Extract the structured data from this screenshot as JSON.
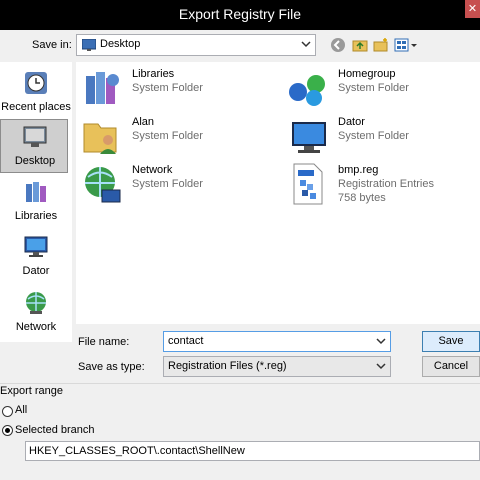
{
  "window": {
    "title": "Export Registry File",
    "close_icon": "close-icon"
  },
  "toolbar": {
    "save_in_label": "Save in:",
    "location": "Desktop",
    "icons": [
      "back-icon",
      "up-folder-icon",
      "new-folder-icon",
      "view-menu-icon"
    ]
  },
  "sidebar": {
    "items": [
      {
        "label": "Recent places",
        "icon": "recent-places-icon",
        "selected": false
      },
      {
        "label": "Desktop",
        "icon": "desktop-icon",
        "selected": true
      },
      {
        "label": "Libraries",
        "icon": "libraries-icon",
        "selected": false
      },
      {
        "label": "Dator",
        "icon": "computer-icon",
        "selected": false
      },
      {
        "label": "Network",
        "icon": "network-icon",
        "selected": false
      }
    ]
  },
  "files": [
    {
      "name": "Libraries",
      "type": "System Folder",
      "size": "",
      "icon": "libraries-icon"
    },
    {
      "name": "Homegroup",
      "type": "System Folder",
      "size": "",
      "icon": "homegroup-icon"
    },
    {
      "name": "Alan",
      "type": "System Folder",
      "size": "",
      "icon": "user-folder-icon"
    },
    {
      "name": "Dator",
      "type": "System Folder",
      "size": "",
      "icon": "computer-icon"
    },
    {
      "name": "Network",
      "type": "System Folder",
      "size": "",
      "icon": "network-icon"
    },
    {
      "name": "bmp.reg",
      "type": "Registration Entries",
      "size": "758 bytes",
      "icon": "reg-file-icon"
    }
  ],
  "form": {
    "file_name_label": "File name:",
    "file_name_value": "contact",
    "save_as_type_label": "Save as type:",
    "save_as_type_value": "Registration Files (*.reg)",
    "save_button": "Save",
    "cancel_button": "Cancel"
  },
  "export_range": {
    "label": "Export range",
    "options": [
      {
        "label": "All",
        "checked": false
      },
      {
        "label": "Selected branch",
        "checked": true
      }
    ],
    "branch_value": "HKEY_CLASSES_ROOT\\.contact\\ShellNew"
  },
  "colors": {
    "titlebar": "#000000",
    "dialog": "#f0f0f0",
    "close": "#c75050",
    "secondary_text": "#6d6d6d"
  }
}
